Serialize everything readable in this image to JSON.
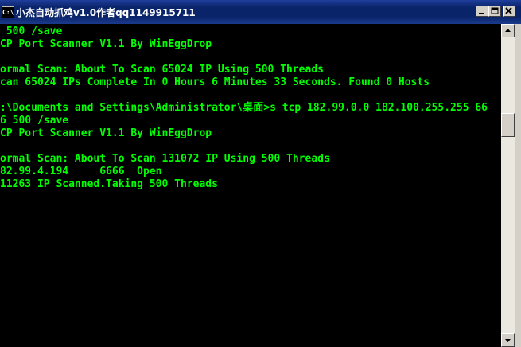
{
  "window": {
    "title": "小杰自动抓鸡v1.0作者qq1149915711",
    "system_icon_label": "C:\\"
  },
  "console": {
    "lines": [
      " 500 /save",
      "CP Port Scanner V1.1 By WinEggDrop",
      "",
      "ormal Scan: About To Scan 65024 IP Using 500 Threads",
      "can 65024 IPs Complete In 0 Hours 6 Minutes 33 Seconds. Found 0 Hosts",
      "",
      ":\\Documents and Settings\\Administrator\\桌面>s tcp 182.99.0.0 182.100.255.255 66",
      "6 500 /save",
      "CP Port Scanner V1.1 By WinEggDrop",
      "",
      "ormal Scan: About To Scan 131072 IP Using 500 Threads",
      "82.99.4.194     6666  Open",
      "11263 IP Scanned.Taking 500 Threads"
    ]
  },
  "colors": {
    "console_bg": "#000000",
    "console_text": "#00ff00",
    "titlebar": "#0a246a"
  },
  "icons": {
    "minimize": "minimize-icon",
    "maximize": "maximize-icon",
    "close": "close-icon",
    "scroll_up": "arrow-up-icon",
    "scroll_down": "arrow-down-icon"
  }
}
